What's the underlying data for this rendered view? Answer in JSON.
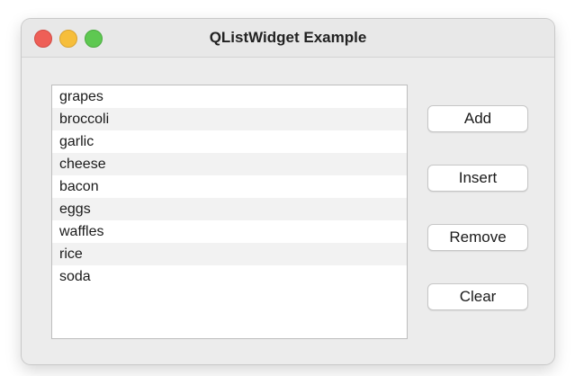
{
  "window": {
    "title": "QListWidget Example"
  },
  "list": {
    "items": [
      "grapes",
      "broccoli",
      "garlic",
      "cheese",
      "bacon",
      "eggs",
      "waffles",
      "rice",
      "soda"
    ]
  },
  "buttons": {
    "add": "Add",
    "insert": "Insert",
    "remove": "Remove",
    "clear": "Clear"
  },
  "colors": {
    "close": "#ee5f57",
    "minimize": "#f6be3b",
    "maximize": "#5ec851",
    "alt_row": "#f2f2f2"
  }
}
